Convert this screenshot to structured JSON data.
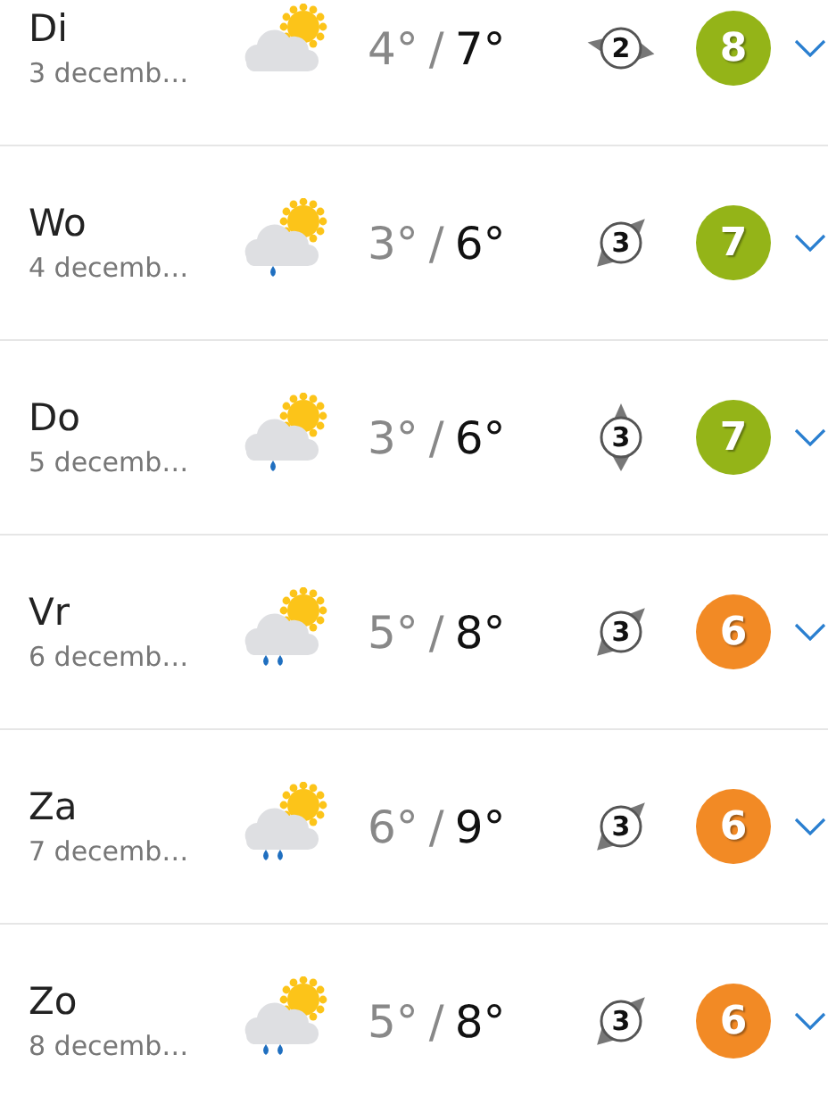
{
  "days": [
    {
      "day": "Di",
      "date": "3 decemb…",
      "weather": {
        "kind": "cloudy"
      },
      "low": "4°",
      "separator": "/",
      "high": "7°",
      "wind": {
        "force": "2",
        "kind": "west"
      },
      "score": "8",
      "color": "#94b418"
    },
    {
      "day": "Wo",
      "date": "4 decemb…",
      "weather": {
        "kind": "drizzle"
      },
      "low": "3°",
      "separator": "/",
      "high": "6°",
      "wind": {
        "force": "3",
        "kind": "northeast"
      },
      "score": "7",
      "color": "#94b418"
    },
    {
      "day": "Do",
      "date": "5 decemb…",
      "weather": {
        "kind": "drizzle"
      },
      "low": "3°",
      "separator": "/",
      "high": "6°",
      "wind": {
        "force": "3",
        "kind": "north"
      },
      "score": "7",
      "color": "#94b418"
    },
    {
      "day": "Vr",
      "date": "6 decemb…",
      "weather": {
        "kind": "rain"
      },
      "low": "5°",
      "separator": "/",
      "high": "8°",
      "wind": {
        "force": "3",
        "kind": "northeast"
      },
      "score": "6",
      "color": "#f28a25"
    },
    {
      "day": "Za",
      "date": "7 decemb…",
      "weather": {
        "kind": "rain"
      },
      "low": "6°",
      "separator": "/",
      "high": "9°",
      "wind": {
        "force": "3",
        "kind": "northeast"
      },
      "score": "6",
      "color": "#f28a25"
    },
    {
      "day": "Zo",
      "date": "8 decemb…",
      "weather": {
        "kind": "rain"
      },
      "low": "5°",
      "separator": "/",
      "high": "8°",
      "wind": {
        "force": "3",
        "kind": "northeast"
      },
      "score": "6",
      "color": "#f28a25"
    }
  ]
}
